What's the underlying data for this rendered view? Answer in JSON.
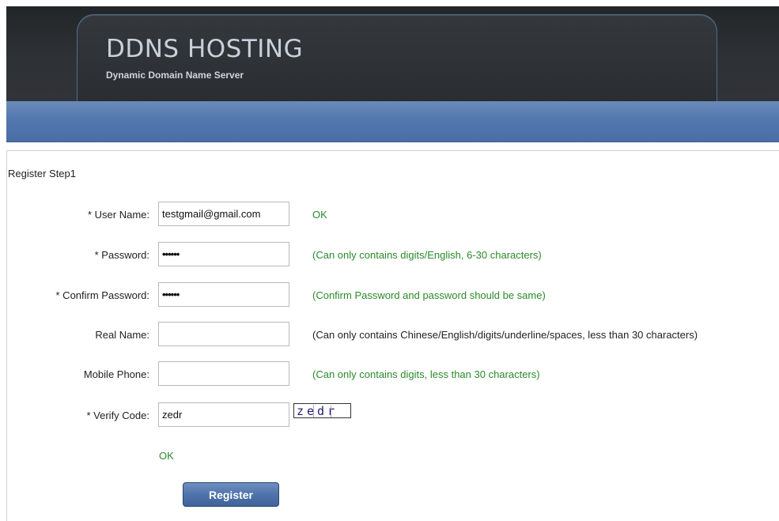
{
  "header": {
    "title": "DDNS HOSTING",
    "subtitle": "Dynamic Domain Name Server"
  },
  "form": {
    "step_title": "Register Step1",
    "fields": [
      {
        "label": "* User Name:",
        "value": "testgmail@gmail.com",
        "hint": "OK"
      },
      {
        "label": "* Password:",
        "value": "••••••",
        "hint": "(Can only contains digits/English, 6-30 characters)"
      },
      {
        "label": "* Confirm Password:",
        "value": "••••••",
        "hint": "(Confirm Password and password should be same)"
      },
      {
        "label": "Real Name:",
        "value": "",
        "hint": "(Can only contains Chinese/English/digits/underline/spaces, less than 30 characters)"
      },
      {
        "label": "Mobile Phone:",
        "value": "",
        "hint": "(Can only contains digits, less than 30 characters)"
      },
      {
        "label": "* Verify Code:",
        "value": "zedr",
        "hint": ""
      }
    ],
    "captcha_text": "zedr",
    "verify_status": "OK",
    "register_label": "Register"
  },
  "colors": {
    "hint_green": "#2a8a2a",
    "nav_blue": "#5176ad",
    "header_dark": "#2e3135"
  }
}
